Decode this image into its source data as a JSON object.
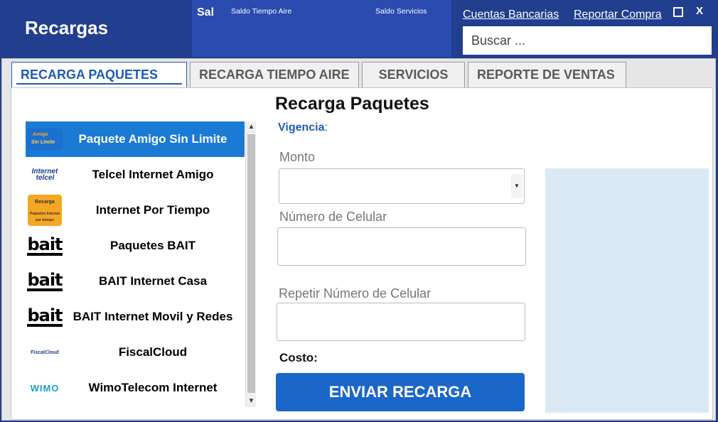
{
  "header": {
    "title": "Recargas",
    "balances": {
      "sal": "Sal",
      "tiempo_aire": "Saldo Tiempo Aire",
      "servicios": "Saldo Servicios"
    },
    "links": {
      "cuentas": "Cuentas Bancarias",
      "reportar": "Reportar Compra"
    },
    "window_controls": {
      "close": "X"
    },
    "search": {
      "placeholder": "Buscar ..."
    }
  },
  "tabs": [
    {
      "label": "RECARGA PAQUETES",
      "active": true
    },
    {
      "label": "RECARGA TIEMPO AIRE"
    },
    {
      "label": "SERVICIOS"
    },
    {
      "label": "REPORTE DE VENTAS"
    }
  ],
  "products": [
    {
      "name": "Paquete Amigo Sin Limite",
      "icon": "amigo-sin-limite-logo",
      "selected": true
    },
    {
      "name": "Telcel Internet Amigo",
      "icon": "internet-telcel-logo"
    },
    {
      "name": "Internet Por Tiempo",
      "icon": "recarga-internet-logo"
    },
    {
      "name": "Paquetes BAIT",
      "icon": "bait-logo"
    },
    {
      "name": "BAIT Internet Casa",
      "icon": "bait-logo"
    },
    {
      "name": "BAIT Internet Movil y Redes",
      "icon": "bait-logo"
    },
    {
      "name": "FiscalCloud",
      "icon": "fiscalcloud-logo"
    },
    {
      "name": "WimoTelecom Internet",
      "icon": "wimo-logo"
    }
  ],
  "logo_text": {
    "amigo_1": "Amigo",
    "amigo_2": "Sin Límite",
    "internet_1": "Internet",
    "internet_2": "telcel",
    "recarga_1": "Recarga",
    "recarga_2": "Paquetes Internet por tiempo",
    "bait": "bait",
    "fiscal": "FiscalCloud",
    "wimo": "WIMO"
  },
  "form": {
    "title": "Recarga Paquetes",
    "vigencia_label": "Vigencia",
    "monto_label": "Monto",
    "monto_value": "",
    "celular_label": "Número de Celular",
    "repetir_label": "Repetir Número de Celular",
    "costo_label": "Costo:",
    "submit_label": "ENVIAR RECARGA"
  },
  "colors": {
    "header_bg": "#213e8f",
    "accent": "#1b66c9",
    "selected_item": "#1b7ad4",
    "tab_active": "#1f5bb5",
    "side_panel": "#dbe9f4"
  }
}
